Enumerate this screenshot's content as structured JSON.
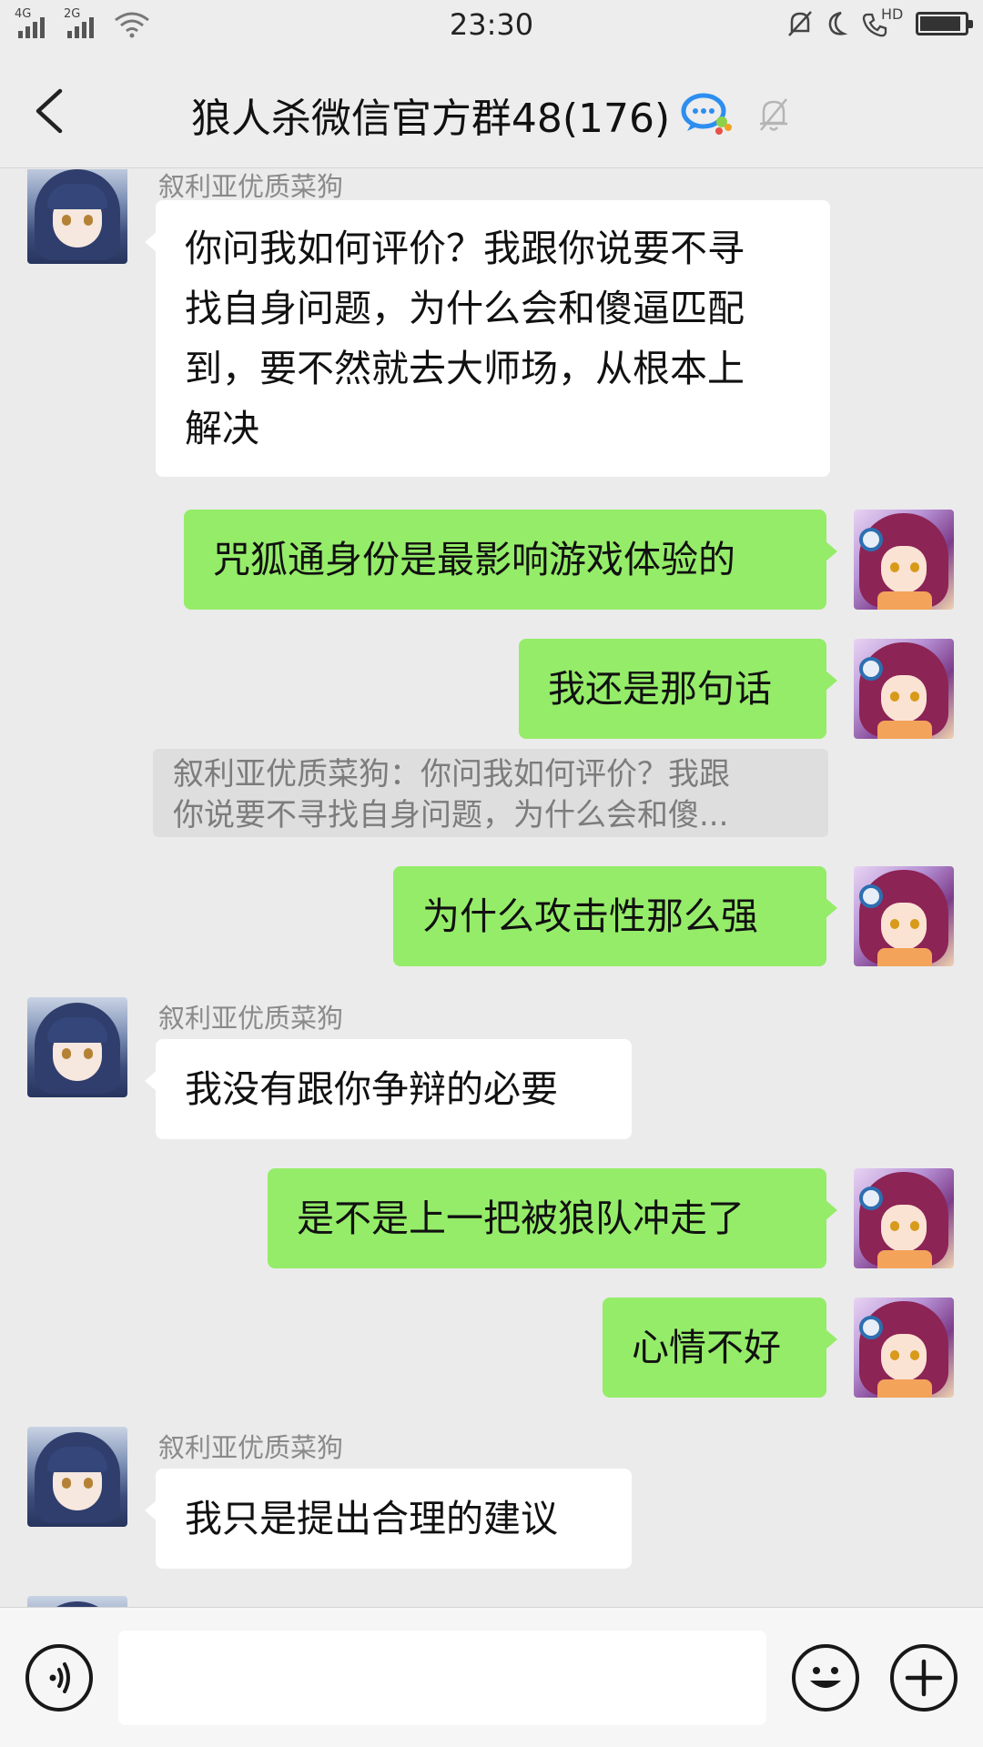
{
  "status_bar": {
    "time": "23:30",
    "network_1": "4G",
    "network_2": "2G",
    "hd_label": "HD",
    "battery_level_percent": 92
  },
  "header": {
    "title": "狼人杀微信官方群48(176)",
    "back_icon": "chevron-left-icon",
    "app_badge_icon": "chat-bubble-icon",
    "mute_icon": "muted-bell-icon"
  },
  "messages": [
    {
      "side": "left",
      "sender": "叙利亚优质菜狗",
      "lines": [
        "你问我如何评价？我跟你说要不寻",
        "找自身问题，为什么会和傻逼匹配",
        "到，要不然就去大师场，从根本上",
        "解决"
      ]
    },
    {
      "side": "right",
      "lines": [
        "咒狐通身份是最影响游戏体验的"
      ]
    },
    {
      "side": "right",
      "lines": [
        "我还是那句话"
      ],
      "quote_lines": [
        "叙利亚优质菜狗：你问我如何评价？我跟",
        "你说要不寻找自身问题，为什么会和傻..."
      ]
    },
    {
      "side": "right",
      "lines": [
        "为什么攻击性那么强"
      ]
    },
    {
      "side": "left",
      "sender": "叙利亚优质菜狗",
      "lines": [
        "我没有跟你争辩的必要"
      ]
    },
    {
      "side": "right",
      "lines": [
        "是不是上一把被狼队冲走了"
      ]
    },
    {
      "side": "right",
      "lines": [
        "心情不好"
      ]
    },
    {
      "side": "left",
      "sender": "叙利亚优质菜狗",
      "lines": [
        "我只是提出合理的建议"
      ]
    }
  ],
  "input_bar": {
    "voice_icon": "voice-icon",
    "text_value": "",
    "emoji_icon": "emoji-icon",
    "plus_icon": "plus-icon"
  },
  "colors": {
    "chat_background": "#ebebeb",
    "sent_bubble": "#95ec69",
    "received_bubble": "#ffffff",
    "quote_background": "#dedede"
  }
}
